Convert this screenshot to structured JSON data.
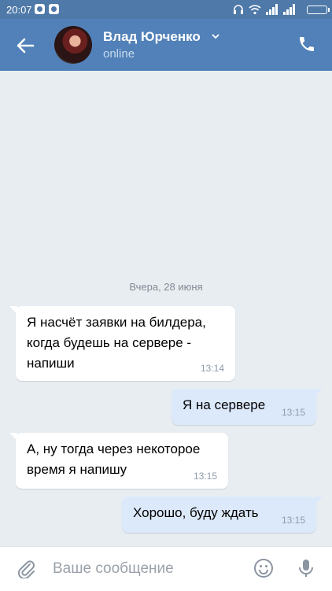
{
  "statusbar": {
    "time": "20:07"
  },
  "header": {
    "name": "Влад Юрченко",
    "status": "online"
  },
  "date_divider": "Вчера, 28 июня",
  "messages": [
    {
      "direction": "in",
      "lines": [
        "Я насчёт заявки на билдера,",
        "когда будешь на сервере -",
        "напиши"
      ],
      "time": "13:14"
    },
    {
      "direction": "out",
      "lines": [
        "Я на сервере"
      ],
      "time": "13:15"
    },
    {
      "direction": "in",
      "lines": [
        "А, ну тогда через некоторое",
        "время я напишу"
      ],
      "time": "13:15"
    },
    {
      "direction": "out",
      "lines": [
        "Хорошо, буду ждать"
      ],
      "time": "13:15"
    }
  ],
  "composer": {
    "placeholder": "Ваше сообщение"
  },
  "colors": {
    "header": "#5181b8",
    "statusbar": "#4e79a8",
    "background": "#e8edf2",
    "outgoing": "#dce9fb"
  },
  "icons": [
    "back-arrow-icon",
    "call-icon",
    "chevron-down-icon",
    "attach-icon",
    "emoji-icon",
    "microphone-icon"
  ]
}
